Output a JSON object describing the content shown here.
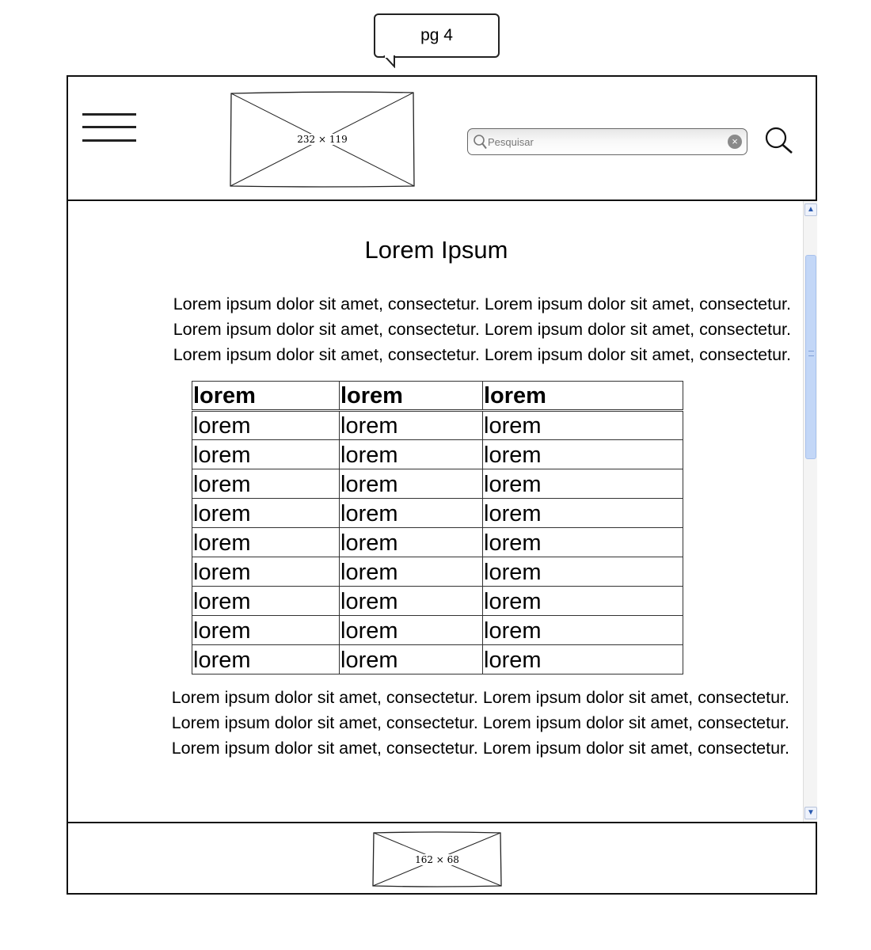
{
  "annotation": {
    "bubble_text": "pg 4"
  },
  "header": {
    "menu_icon": "hamburger-menu-icon",
    "logo_placeholder": {
      "label": "232 × 119"
    },
    "search": {
      "placeholder": "Pesquisar",
      "value": "",
      "clear_icon": "clear-circle-icon",
      "leading_icon": "magnifier-icon"
    },
    "search_button_icon": "magnifier-icon"
  },
  "main": {
    "title": "Lorem Ipsum",
    "paragraph_top": [
      "Lorem ipsum dolor sit amet, consectetur. Lorem ipsum dolor sit amet, consectetur.",
      "Lorem ipsum dolor sit amet, consectetur. Lorem ipsum dolor sit amet, consectetur.",
      "Lorem ipsum dolor sit amet, consectetur. Lorem ipsum dolor sit amet, consectetur."
    ],
    "table": {
      "headers": [
        "lorem",
        "lorem",
        "lorem"
      ],
      "rows": [
        [
          "lorem",
          "lorem",
          "lorem"
        ],
        [
          "lorem",
          "lorem",
          "lorem"
        ],
        [
          "lorem",
          "lorem",
          "lorem"
        ],
        [
          "lorem",
          "lorem",
          "lorem"
        ],
        [
          "lorem",
          "lorem",
          "lorem"
        ],
        [
          "lorem",
          "lorem",
          "lorem"
        ],
        [
          "lorem",
          "lorem",
          "lorem"
        ],
        [
          "lorem",
          "lorem",
          "lorem"
        ],
        [
          "lorem",
          "lorem",
          "lorem"
        ]
      ]
    },
    "paragraph_bottom": [
      "Lorem ipsum dolor sit amet, consectetur. Lorem ipsum dolor sit amet, consectetur.",
      "Lorem ipsum dolor sit amet, consectetur. Lorem ipsum dolor sit amet, consectetur.",
      "Lorem ipsum dolor sit amet, consectetur. Lorem ipsum dolor sit amet, consectetur."
    ]
  },
  "footer": {
    "image_placeholder": {
      "label": "162 × 68"
    }
  },
  "colors": {
    "scroll_thumb": "#c3d7f7",
    "frame_border": "#111111"
  }
}
